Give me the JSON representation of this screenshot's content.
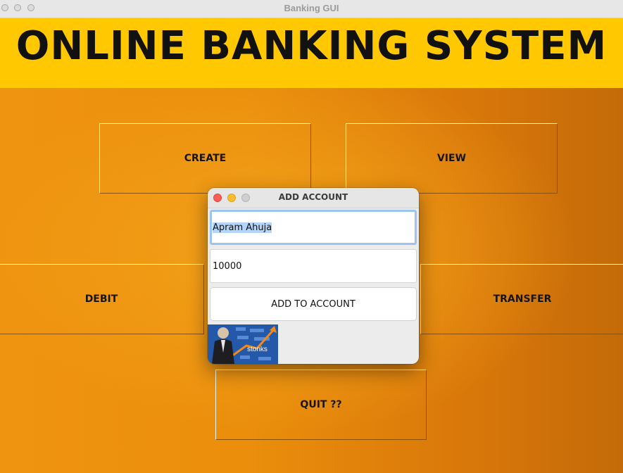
{
  "window": {
    "title": "Banking GUI"
  },
  "banner": {
    "title": "ONLINE BANKING SYSTEM"
  },
  "buttons": {
    "create": "CREATE",
    "view": "VIEW",
    "debit": "DEBIT",
    "transfer": "TRANSFER",
    "quit": "QUIT ??"
  },
  "dialog": {
    "title": "ADD ACCOUNT",
    "name_value": "Apram Ahuja",
    "amount_value": "10000",
    "submit_label": "ADD TO ACCOUNT",
    "image_caption": "stonks"
  },
  "colors": {
    "banner": "#ffc800",
    "background": "#e0870a",
    "close": "#ff5f57",
    "minimize": "#febc2e"
  }
}
